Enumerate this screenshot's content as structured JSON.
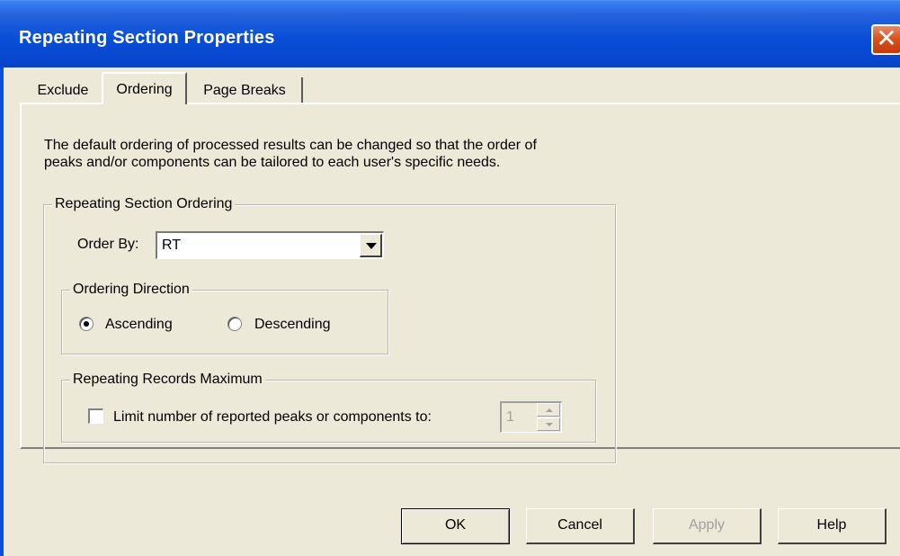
{
  "window": {
    "title": "Repeating Section Properties",
    "close_glyph": "✕",
    "accent_color": "#0a4fd8"
  },
  "tabs": [
    {
      "label": "Exclude",
      "active": false
    },
    {
      "label": "Ordering",
      "active": true
    },
    {
      "label": "Page Breaks",
      "active": false
    }
  ],
  "panel": {
    "description_line1": "The default ordering of processed results can be changed so that the order of",
    "description_line2": "peaks and/or components can be tailored to each user's specific needs.",
    "ordering_group": {
      "legend": "Repeating Section Ordering",
      "order_by_label": "Order By:",
      "order_by_value": "RT",
      "direction_group": {
        "legend": "Ordering Direction",
        "options": [
          {
            "label": "Ascending",
            "checked": true
          },
          {
            "label": "Descending",
            "checked": false
          }
        ]
      },
      "records_group": {
        "legend": "Repeating Records Maximum",
        "limit_label": "Limit number of reported peaks or components to:",
        "limit_checked": false,
        "limit_value": "1"
      }
    }
  },
  "buttons": {
    "ok": "OK",
    "cancel": "Cancel",
    "apply": "Apply",
    "help": "Help"
  }
}
